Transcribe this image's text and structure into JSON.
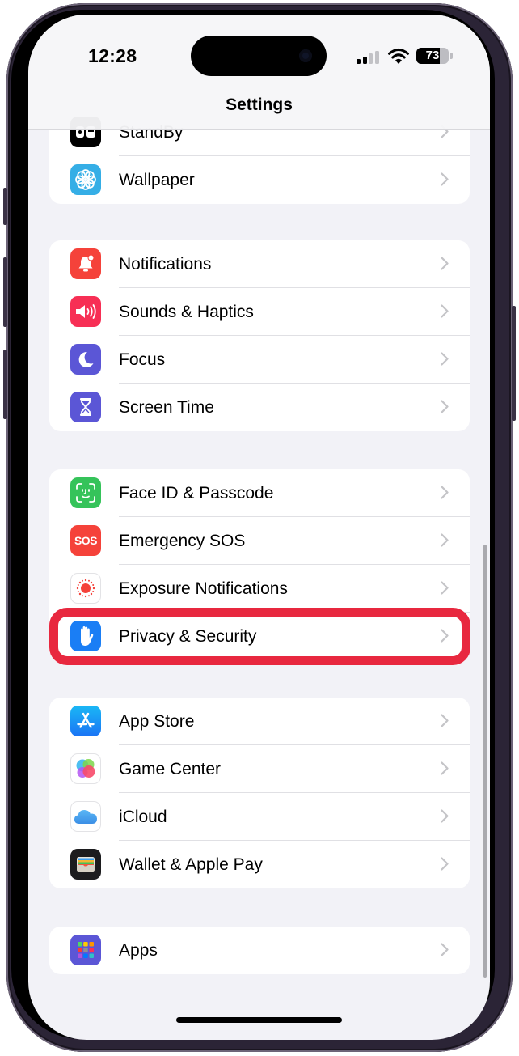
{
  "status_bar": {
    "time": "12:28",
    "signal_bars_active": 2,
    "signal_bars_total": 4,
    "wifi": "wifi-icon",
    "battery_percent": "73",
    "battery_level": 0.73
  },
  "nav": {
    "title": "Settings"
  },
  "groups": [
    {
      "items": [
        {
          "label": "StandBy",
          "icon": "standby-icon",
          "color": "#000000"
        },
        {
          "label": "Wallpaper",
          "icon": "wallpaper-icon",
          "color": "#35aee6"
        }
      ]
    },
    {
      "items": [
        {
          "label": "Notifications",
          "icon": "notifications-icon",
          "color": "#f5423a"
        },
        {
          "label": "Sounds & Haptics",
          "icon": "sounds-icon",
          "color": "#f72f55"
        },
        {
          "label": "Focus",
          "icon": "focus-moon-icon",
          "color": "#5b56d6"
        },
        {
          "label": "Screen Time",
          "icon": "hourglass-icon",
          "color": "#5b56d6"
        }
      ]
    },
    {
      "items": [
        {
          "label": "Face ID & Passcode",
          "icon": "face-id-icon",
          "color": "#35c35a"
        },
        {
          "label": "Emergency SOS",
          "icon": "sos-icon",
          "color": "#f5423a",
          "icon_text": "SOS"
        },
        {
          "label": "Exposure Notifications",
          "icon": "exposure-icon",
          "color": "#ffffff"
        },
        {
          "label": "Privacy & Security",
          "icon": "hand-icon",
          "color": "#1a7ef5",
          "highlighted": true
        }
      ]
    },
    {
      "items": [
        {
          "label": "App Store",
          "icon": "app-store-icon",
          "color": "#1b8ff5"
        },
        {
          "label": "Game Center",
          "icon": "game-center-icon",
          "color": "#ffffff"
        },
        {
          "label": "iCloud",
          "icon": "icloud-icon",
          "color": "#ffffff"
        },
        {
          "label": "Wallet & Apple Pay",
          "icon": "wallet-icon",
          "color": "#1c1c1e"
        }
      ]
    },
    {
      "items": [
        {
          "label": "Apps",
          "icon": "apps-grid-icon",
          "color": "#5b56d6"
        }
      ]
    }
  ],
  "highlight_color": "#e8283f"
}
